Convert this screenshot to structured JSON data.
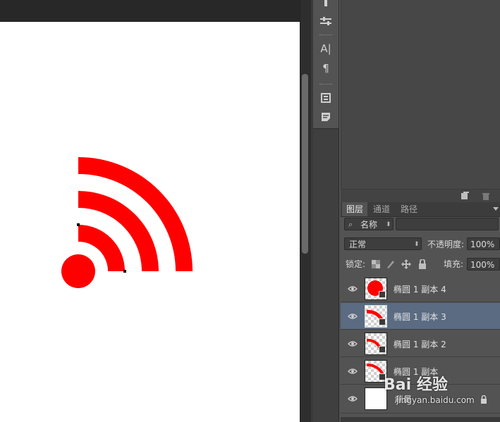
{
  "colors": {
    "wifi_red": "#ff0000",
    "selected_row": "#5a6b82",
    "panel_bg": "#535353"
  },
  "toolbar_icons": [
    "brush-preset-icon",
    "adjustment-icon",
    "character-icon",
    "paragraph-icon",
    "styles-icon",
    "notes-icon"
  ],
  "tool_labels": {
    "character": "A|",
    "paragraph": "¶"
  },
  "layers_panel": {
    "tabs": [
      "图层",
      "通道",
      "路径"
    ],
    "active_tab": "图层",
    "filter": {
      "kind_label": "名称",
      "search_value": ""
    },
    "blend_mode": "正常",
    "opacity_label": "不透明度:",
    "opacity_value": "100%",
    "lock_label": "锁定:",
    "fill_label": "填充:",
    "fill_value": "100%",
    "layers": [
      {
        "name": "椭圆 1 副本 4",
        "selected": false
      },
      {
        "name": "椭圆 1 副本 3",
        "selected": true
      },
      {
        "name": "椭圆 1 副本 2",
        "selected": false
      },
      {
        "name": "椭圆 1 副本",
        "selected": false
      },
      {
        "name": "背景",
        "selected": false,
        "locked": true
      }
    ]
  },
  "watermark": {
    "brand": "Bai 经验",
    "url": "jingyan.baidu.com"
  }
}
